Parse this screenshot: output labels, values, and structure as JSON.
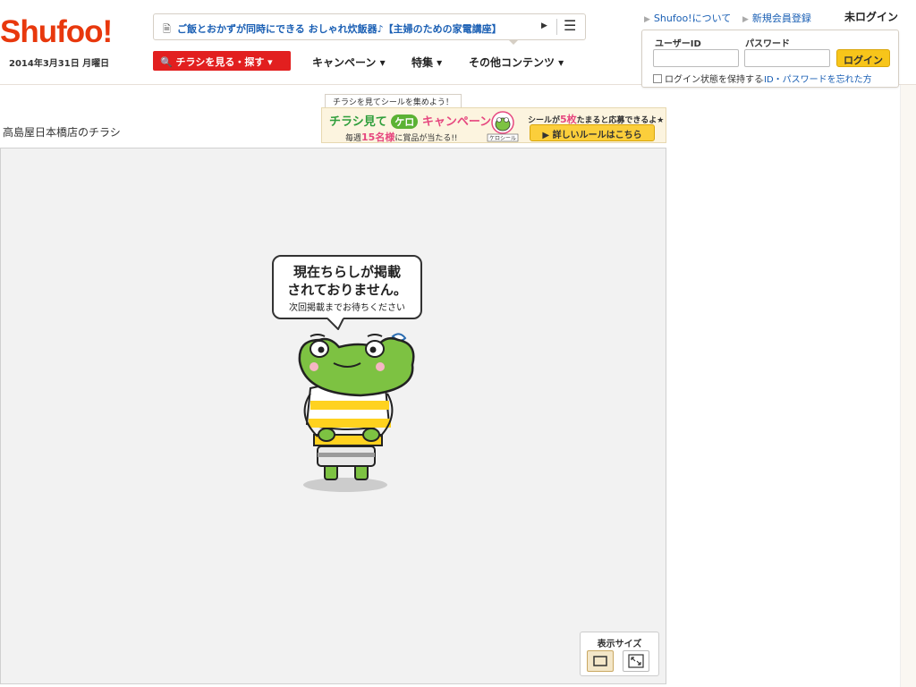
{
  "header": {
    "logo": "Shufoo!",
    "date": "2014年3月31日 月曜日",
    "ticker": {
      "text": "ご飯とおかずが同時にできる おしゃれ炊飯器♪【主婦のための家電講座】",
      "doc_icon": "document-icon",
      "play_icon": "play-icon",
      "menu_icon": "hamburger-icon"
    },
    "nav": {
      "search_label": "チラシを見る・探す ▾",
      "search_icon": "search-icon",
      "items": [
        {
          "label": "キャンペーン ▾"
        },
        {
          "label": "特集 ▾"
        },
        {
          "label": "その他コンテンツ ▾"
        }
      ]
    },
    "links": [
      {
        "label": "Shufoo!について"
      },
      {
        "label": "新規会員登録"
      }
    ],
    "login_status": "未ログイン",
    "login": {
      "user_label": "ユーザーID",
      "pass_label": "パスワード",
      "user_value": "",
      "pass_value": "",
      "button": "ログイン",
      "keep_label": "ログイン状態を保持する",
      "forgot": "ID・パスワードを忘れた方"
    }
  },
  "page_title": "高島屋日本橋店のチラシ",
  "campaign": {
    "tab": "チラシを見てシールを集めよう！",
    "title_a": "チラシ見て",
    "kero": "ケロ",
    "title_b": "キャンペーン",
    "sub_a": "毎週",
    "sub_num": "15名様",
    "sub_b": "に賞品が当たる!!",
    "badge_label": "ケロシール",
    "badge_a": "シールが",
    "badge_num": "5枚",
    "badge_b": "たまると応募できるよ★",
    "rule_button": "▶ 詳しいルールはこちら"
  },
  "viewer": {
    "message_line1": "現在ちらしが掲載",
    "message_line2": "されておりません。",
    "message_line3": "次回掲載までお待ちください",
    "size_label": "表示サイズ",
    "size_options": [
      {
        "name": "normal-size-icon",
        "active": true
      },
      {
        "name": "expand-size-icon",
        "active": false
      }
    ]
  },
  "colors": {
    "brand": "#e8380d",
    "nav_red": "#e21f1f",
    "link": "#1a5fb4",
    "login_button": "#f7c51a",
    "frog_green": "#7dc242",
    "stripe_yellow": "#ffd21f"
  }
}
